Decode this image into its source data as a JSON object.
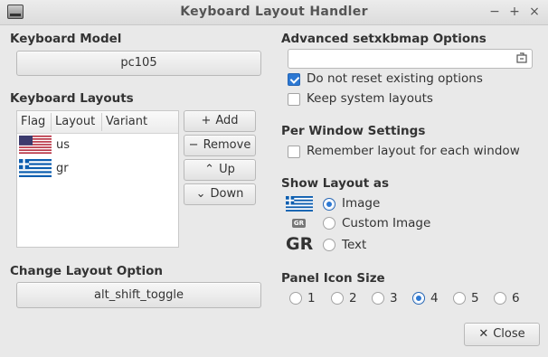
{
  "window": {
    "title": "Keyboard Layout Handler",
    "minimize": "−",
    "maximize": "+",
    "close": "×"
  },
  "keyboard_model": {
    "heading": "Keyboard Model",
    "value": "pc105"
  },
  "keyboard_layouts": {
    "heading": "Keyboard Layouts",
    "columns": [
      "Flag",
      "Layout",
      "Variant"
    ],
    "rows": [
      {
        "flag": "us-flag",
        "layout": "us",
        "variant": ""
      },
      {
        "flag": "greece-flag",
        "layout": "gr",
        "variant": ""
      }
    ],
    "buttons": {
      "add": "Add",
      "remove": "Remove",
      "up": "Up",
      "down": "Down"
    }
  },
  "change_layout": {
    "heading": "Change Layout Option",
    "value": "alt_shift_toggle"
  },
  "advanced": {
    "heading": "Advanced setxkbmap Options",
    "input_value": "",
    "do_not_reset": {
      "label": "Do not reset existing options",
      "checked": true
    },
    "keep_system": {
      "label": "Keep system layouts",
      "checked": false
    }
  },
  "per_window": {
    "heading": "Per Window Settings",
    "remember": {
      "label": "Remember layout for each window",
      "checked": false
    }
  },
  "show_layout": {
    "heading": "Show Layout as",
    "gr_badge": "GR",
    "gr_text": "GR",
    "options": [
      {
        "label": "Image",
        "selected": true
      },
      {
        "label": "Custom Image",
        "selected": false
      },
      {
        "label": "Text",
        "selected": false
      }
    ]
  },
  "panel_icon_size": {
    "heading": "Panel Icon Size",
    "options": [
      "1",
      "2",
      "3",
      "4",
      "5",
      "6"
    ],
    "selected": "4"
  },
  "footer": {
    "close_label": "Close"
  },
  "colors": {
    "accent": "#2c78d3",
    "background": "#e9e9e9"
  }
}
